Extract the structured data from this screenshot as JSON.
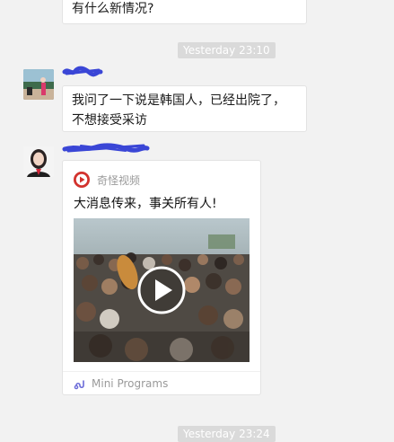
{
  "messages": {
    "top_bubble_text": "有什么新情况?",
    "time_1": "Yesterday 23:10",
    "reply_bubble_text": "我问了一下说是韩国人，已经出院了，不想接受采访",
    "time_2": "Yesterday 23:24"
  },
  "card": {
    "source_name": "奇怪视频",
    "title": "大消息传来，事关所有人!",
    "footer_label": "Mini Programs"
  },
  "colors": {
    "background": "#f2f2f2",
    "bubble": "#ffffff",
    "time_pill": "#dadada",
    "scribble": "#3a46d6",
    "play_brand": "#d2322d"
  },
  "icons": {
    "source": "play-logo-icon",
    "thumbnail_play": "play-button-icon",
    "footer": "mini-program-icon"
  }
}
